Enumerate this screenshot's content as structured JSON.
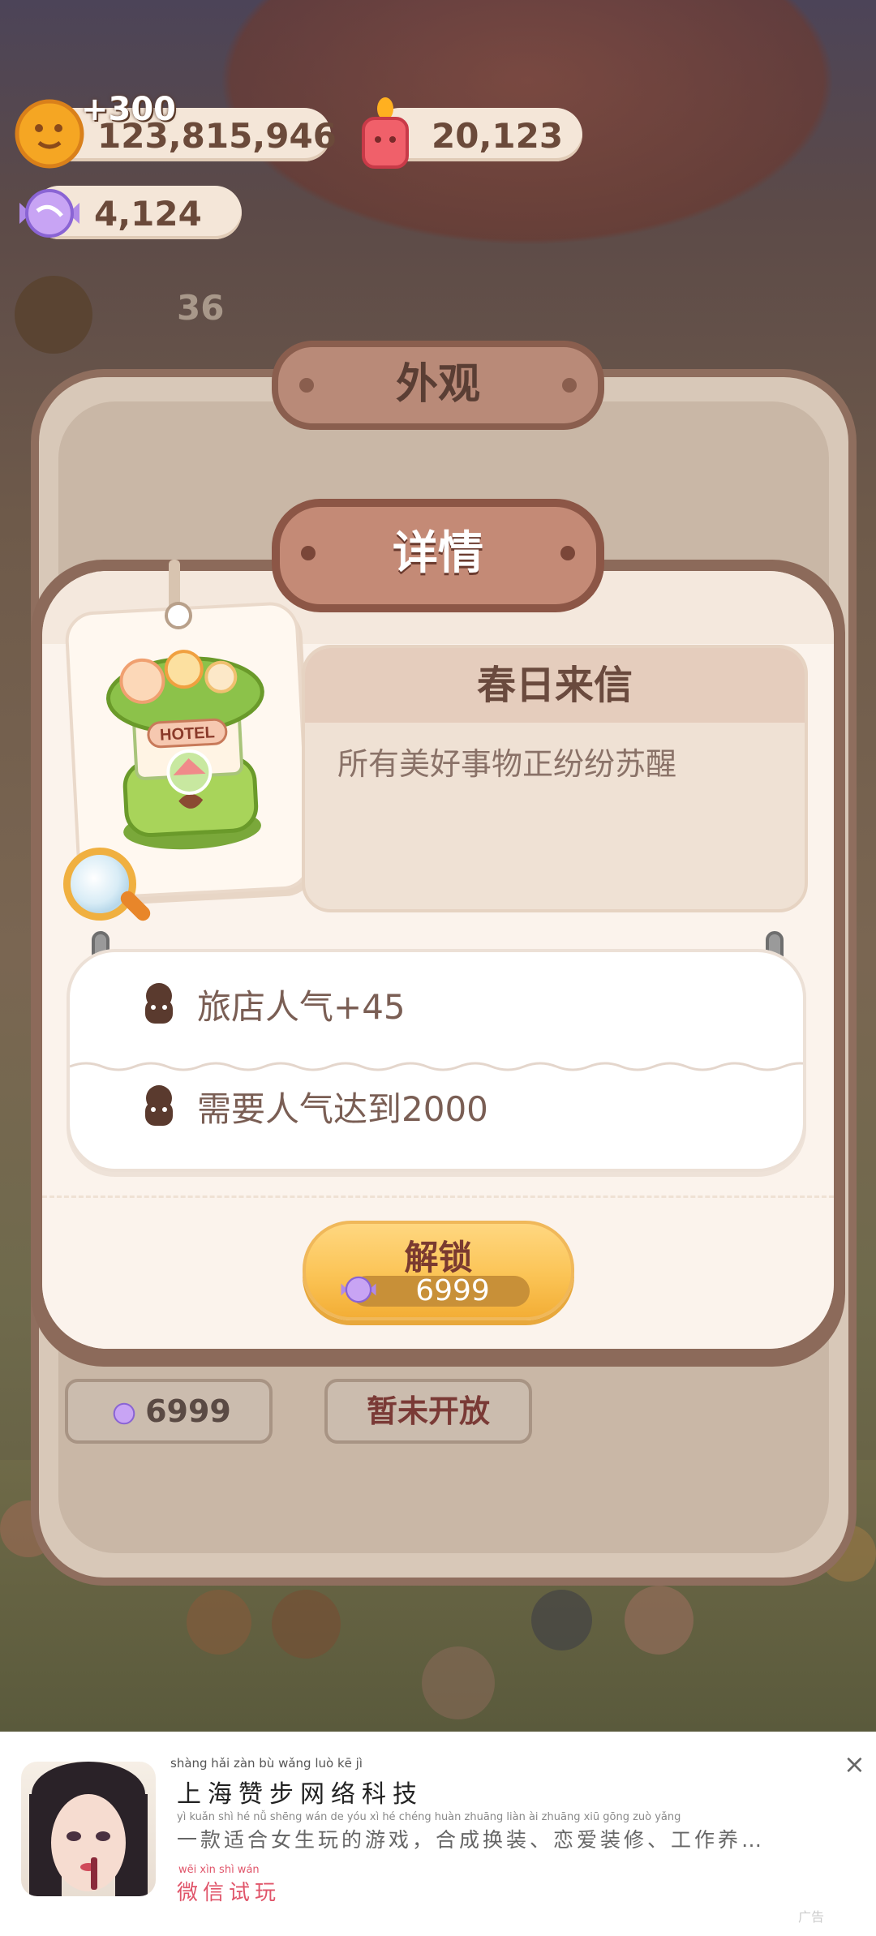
{
  "resources": {
    "coins": "123,815,946",
    "coin_gain": "+300",
    "candles": "20,123",
    "candies": "4,124",
    "side_count": "36"
  },
  "outer_panel": {
    "title": "外观",
    "items": [
      {
        "price": "6999"
      },
      {
        "status": "暂未开放"
      }
    ]
  },
  "dialog": {
    "title": "详情",
    "item_name": "春日来信",
    "item_desc": "所有美好事物正纷纷苏醒",
    "item_image_label": "HOTEL",
    "stats": [
      {
        "text": "旅店人气+45"
      },
      {
        "text": "需要人气达到2000"
      }
    ],
    "unlock_label": "解锁",
    "unlock_price": "6999"
  },
  "ad": {
    "title": "上海赞步网络科技",
    "title_pinyin": "shàng hǎi  zàn  bù wǎng luò  kē   jì",
    "subtitle": "一款适合女生玩的游戏，合成换装、恋爱装修、工作养…",
    "subtitle_pinyin": "yì  kuǎn  shì   hé   nǚ  shēng wán   de   yóu   xì          hé  chéng huàn zhuāng        liàn   ài  zhuāng xiū        gōng zuò yǎng",
    "cta": "微信试玩",
    "cta_pinyin": "wēi  xìn  shì  wán",
    "close_icon": "×",
    "logo": "广告"
  },
  "colors": {
    "dialog_border": "#8c6a5a",
    "banner": "#c48a76",
    "unlock_button": "#fbc456",
    "stat_text": "#7a5e54"
  }
}
